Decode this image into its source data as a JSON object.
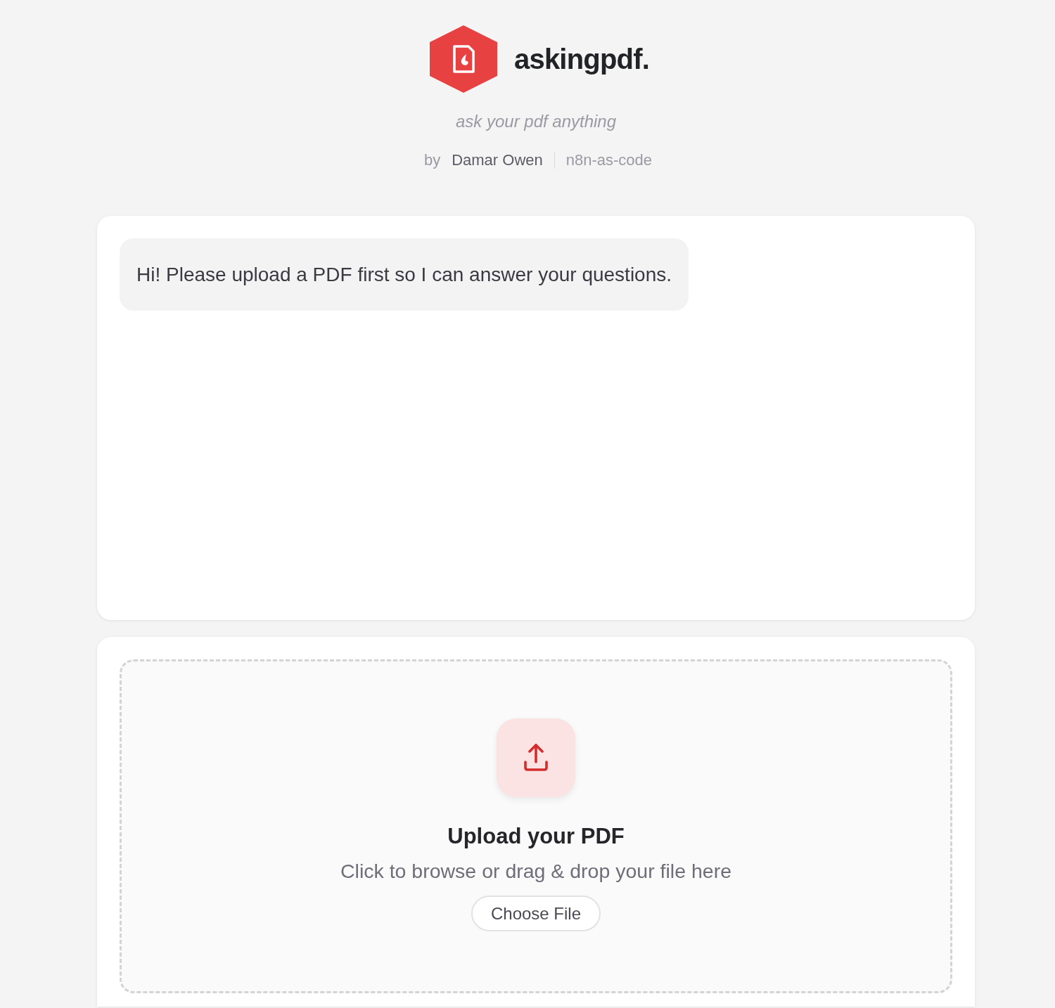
{
  "header": {
    "logo_text": "askingpdf.",
    "tagline": "ask your pdf anything",
    "byline": {
      "prefix": "by",
      "author": "Damar Owen",
      "project": "n8n-as-code"
    }
  },
  "chat": {
    "messages": [
      {
        "text": "Hi! Please upload a PDF first so I can answer your questions."
      }
    ]
  },
  "upload": {
    "title": "Upload your PDF",
    "hint": "Click to browse or drag & drop your file here",
    "button": "Choose File"
  }
}
